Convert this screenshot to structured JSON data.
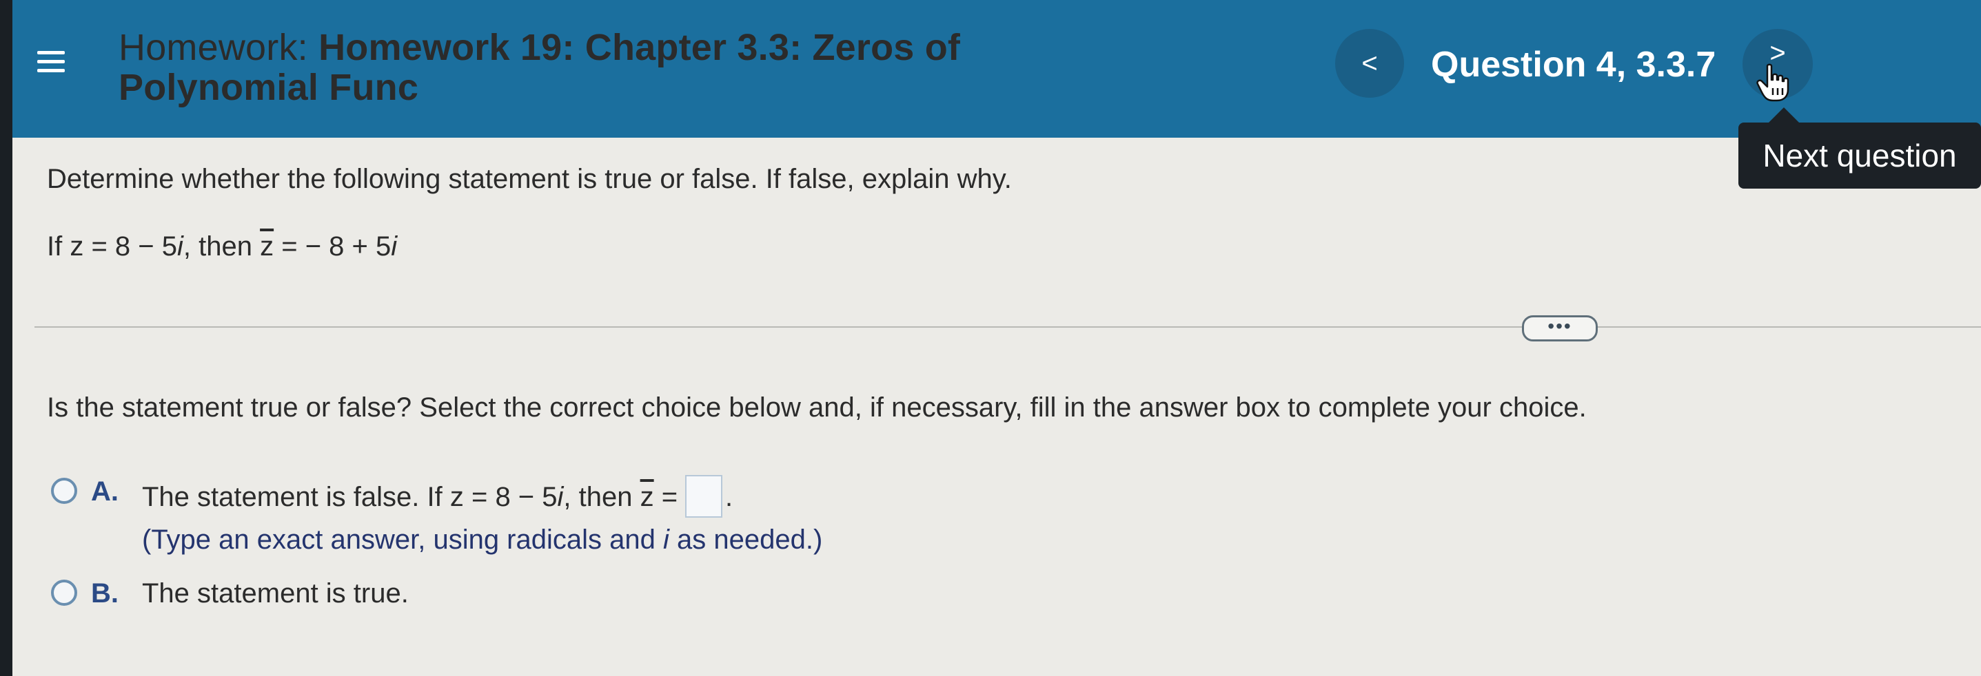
{
  "header": {
    "title_prefix": "Homework: ",
    "title_name": "Homework 19: Chapter 3.3: Zeros of",
    "title_line2": "Polynomial Func",
    "prev_symbol": "<",
    "question_label": "Question 4, 3.3.7",
    "next_symbol": ">",
    "tooltip": "Next question"
  },
  "problem": {
    "instruction": "Determine whether the following statement is true or false. If false, explain why.",
    "statement_part1": "If z = 8 − 5",
    "statement_i1": "i",
    "statement_part2": ", then ",
    "statement_zbar": "z",
    "statement_part3": " = − 8 + 5",
    "statement_i2": "i"
  },
  "more_button": "•••",
  "question": {
    "prompt": "Is the statement true or false? Select the correct choice below and, if necessary, fill in the answer box to complete your choice."
  },
  "choices": [
    {
      "letter": "A.",
      "text_part1": "The statement is false. If z = 8 − 5",
      "text_i": "i",
      "text_part2": ", then ",
      "text_zbar": "z",
      "text_part3": " =",
      "text_end": ".",
      "hint_part1": "(Type an exact answer, using radicals and ",
      "hint_i": "i",
      "hint_part2": " as needed.)"
    },
    {
      "letter": "B.",
      "text": "The statement is true."
    }
  ]
}
